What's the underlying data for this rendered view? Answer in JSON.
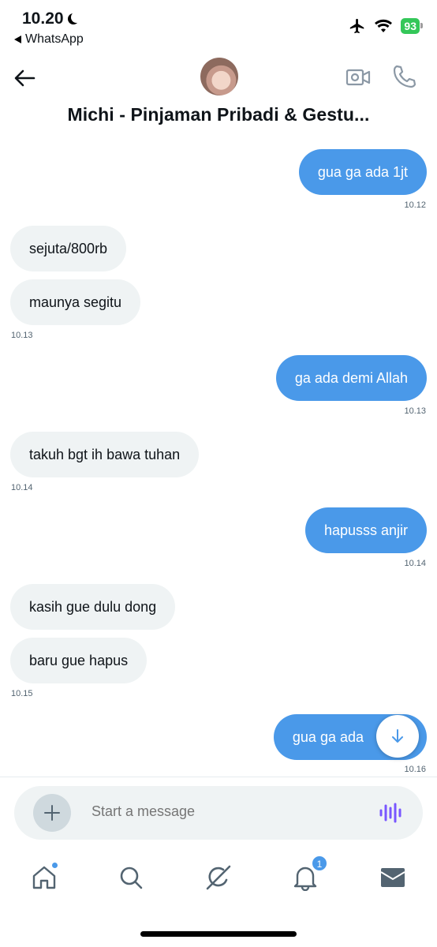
{
  "status_bar": {
    "time": "10.20",
    "back_app": "WhatsApp",
    "battery": "93"
  },
  "header": {
    "title": "Michi - Pinjaman Pribadi & Gestu..."
  },
  "messages": [
    {
      "text": "gua ga ada 1jt",
      "direction": "out"
    },
    {
      "time": "10.12"
    },
    {
      "text": "sejuta/800rb",
      "direction": "in"
    },
    {
      "text": "maunya segitu",
      "direction": "in"
    },
    {
      "time": "10.13"
    },
    {
      "text": "ga ada demi Allah",
      "direction": "out"
    },
    {
      "time": "10.13"
    },
    {
      "text": "takuh bgt ih bawa tuhan",
      "direction": "in"
    },
    {
      "time": "10.14"
    },
    {
      "text": "hapusss anjir",
      "direction": "out"
    },
    {
      "time": "10.14"
    },
    {
      "text": "kasih gue dulu dong",
      "direction": "in"
    },
    {
      "text": "baru gue hapus",
      "direction": "in"
    },
    {
      "time": "10.15"
    },
    {
      "text": "gua ga ada",
      "direction": "out"
    },
    {
      "time": "10.16"
    }
  ],
  "composer": {
    "placeholder": "Start a message"
  },
  "nav": {
    "notifications_badge": "1"
  },
  "colors": {
    "outgoing_bubble": "#4a99e9",
    "incoming_bubble": "#eff3f4",
    "voice_accent": "#7856ff",
    "battery_green": "#34c759"
  },
  "icons": [
    "back-arrow-icon",
    "video-call-icon",
    "phone-icon",
    "scroll-down-icon",
    "plus-icon",
    "voice-message-icon",
    "home-icon",
    "search-icon",
    "grok-icon",
    "notifications-icon",
    "messages-icon"
  ]
}
